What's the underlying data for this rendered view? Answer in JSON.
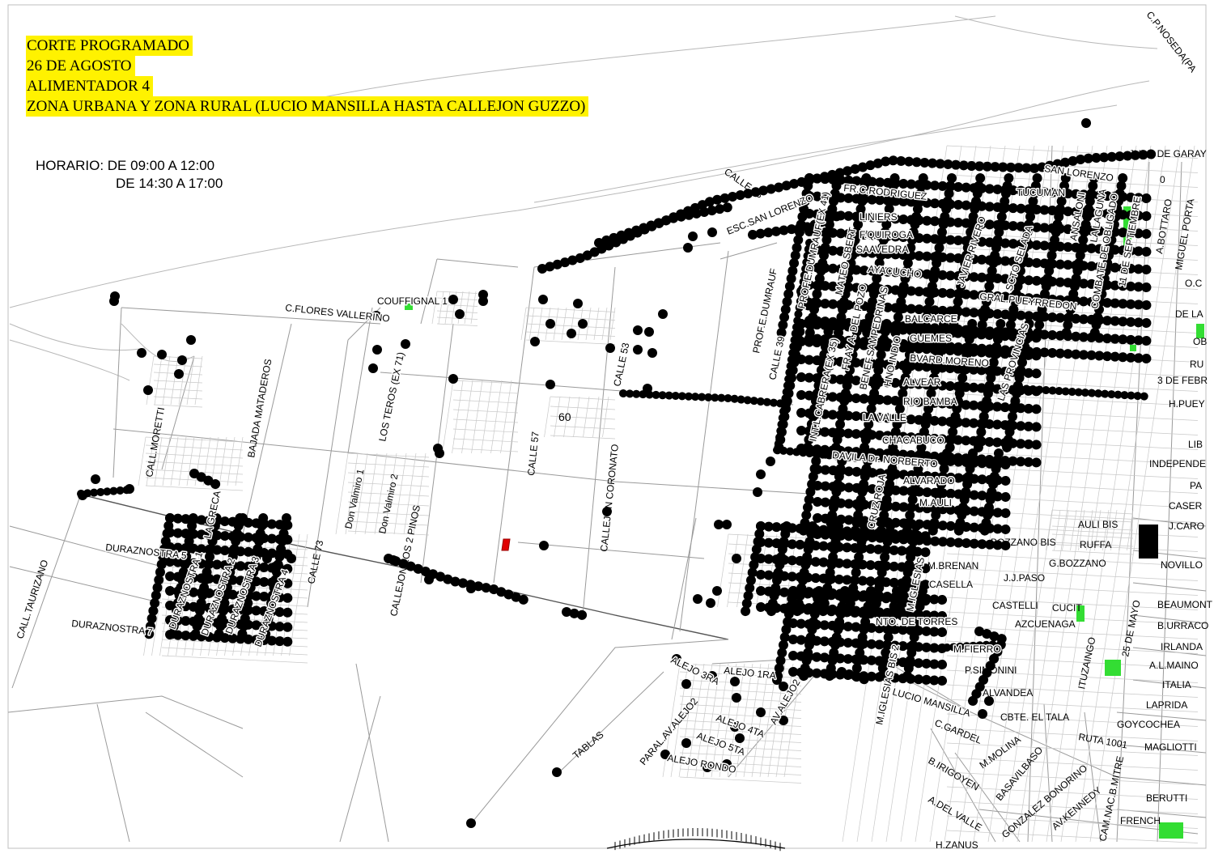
{
  "header": {
    "line1": "CORTE PROGRAMADO",
    "line2": "26 DE AGOSTO",
    "line3": "ALIMENTADOR 4",
    "line4": "ZONA URBANA  Y ZONA RURAL (LUCIO MANSILLA HASTA CALLEJON GUZZO)"
  },
  "schedule": {
    "label": "HORARIO: DE 09:00 A 12:00",
    "label2": "DE 14:30 A 17:00"
  },
  "colors": {
    "highlight": "#fff200",
    "affected": "#000000",
    "park": "#33dd33",
    "marker": "#e00000"
  },
  "labels": {
    "cp_noseda": "C.P.NOSEDA(PA",
    "juan_de_garay": "JUAN DE GARAY",
    "san_lorenzo": "SAN LORENZO",
    "calle_43": "CALLE 43",
    "esc_san_lorenzo": "ESC.SAN LORENZO",
    "fr_rodriguez": "FR.C.RODRIGUEZ",
    "tucuman": "TUCUMAN",
    "ansaloni": "ANSALONI",
    "la_laguna": "LA LAGUNA",
    "combate": "COMBATE DE OBLIGADO",
    "once_sept": "11 DE SEPTIEMBRE",
    "a_bottaro": "A.BOTTARO",
    "miguel_porta": "MIGUEL PORTA",
    "liniers": "LINIERS",
    "f_quiroga": "F.QUIROGA",
    "saavedra": "SAAVEDRA",
    "ayacucho": "AYACUCHO",
    "javier_rivero": "JAVIER RIVERO",
    "scto_selada": "SCTO SELADA",
    "gral_pueyrredon": "GRAL.PUEYRREDON",
    "mateo_sbert": "MATEO SBERT",
    "prof_dumrauf_41": "PROF.E.DUMRAUF(EX 41)",
    "prof_dumrauf": "PROF.E.DUMRAUF",
    "balcarce": "BALCARCE",
    "guemes": "GUEMES",
    "bvard_moreno": "BVARD.MORENO",
    "las_provincias": "LAS PROVINCIAS",
    "alvear": "ALVEAR",
    "rio_bamba": "RIO BAMBA",
    "la_valle": "LA VALLE",
    "chacabuco": "CHACABUCO",
    "fray_del_pozo": "FRAY A. DEL POZO",
    "benef_sampedrinas": "BENEF.SAMPEDRINAS",
    "hno_indio": "HNO.INDIO",
    "calle_39": "CALLE 39",
    "int_cabrera": "INT.L.CABRERA(EX 35)",
    "davila": "DAVILA Dr. NORBERTO",
    "alvarado": "ALVARADO",
    "m_auli": "M.AULI",
    "cruz_roja": "CRUZ ROJA",
    "auli_bis": "AULI BIS",
    "bozzano_bis": "BOZZANO BIS",
    "ruffa": "RUFFA",
    "j_caro": "J.CARO",
    "g_bozzano": "G.BOZZANO",
    "m_brenan": "M.BRENAN",
    "jj_paso": "J.J.PASO",
    "novillo": "NOVILLO",
    "casella": "CASELLA",
    "m_iglesias": "M.IGLESIAS",
    "castelli": "CASTELLI",
    "cucit": "CUCIT",
    "azcuenaga": "AZCUENAGA",
    "beaumont": "BEAUMONT",
    "b_urraco": "B.URRACO",
    "nto_torres": "NTO. DE TORRES",
    "m_fierro": "M.FIERRO",
    "ituzaingo": "ITUZAINGO",
    "veinticinco_mayo": "25 DE MAYO",
    "irlanda": "IRLANDA",
    "a_maino": "A.L.MAINO",
    "p_simonini": "P.SIMONINI",
    "m_iglesias_bis": "M.IGLESIAS BIS 2",
    "alvandea": "ALVANDEA",
    "italia": "ITALIA",
    "laprida": "LAPRIDA",
    "lucio_mansilla": "LUCIO MANSILLA",
    "cbte_el_tala": "CBTE. EL TALA",
    "goycochea": "GOYCOCHEA",
    "c_gardel": "C.GARDEL",
    "ruta_1001": "RUTA 1001",
    "magliotti": "MAGLIOTTI",
    "m_molina": "M.MOLINA",
    "b_irigoyen": "B.IRIGOYEN",
    "basavilbaso": "BASAVILBASO",
    "gonzalez_bonorino": "GONZALEZ BONORINO",
    "av_kennedy": "AV.KENNEDY",
    "cam_nac_mitre": "CAM.NAC.B.MITRE",
    "berutti": "BERUTTI",
    "a_del_valle": "A.DEL VALLE",
    "french": "FRENCH",
    "h_zanus": "H.ZANUS",
    "o_c": "O.C",
    "de_la": "DE LA",
    "ob": "OB",
    "ru": "RU",
    "tres_feb": "3 DE FEBR",
    "h_puey": "H.PUEY",
    "lib": "LIB",
    "independ": "INDEPENDE",
    "pa": "PA",
    "caser": "CASER",
    "cero": "0",
    "alejo_3ra": "ALEJO 3RA",
    "alejo_1ra": "ALEJO 1RA",
    "alejo_4ta": "ALEJO 4TA",
    "alejo_5ta": "ALEJO 5TA",
    "alejo_2": "AV.ALEJO2",
    "alejo_rondo": "ALEJO RONDO",
    "paral_av_alejo": "PARAL.AV.ALEJO2",
    "tablas": "TABLAS",
    "coufignal": "COUFFIGNAL 1",
    "c_flores": "C.FLORES VALLERINO",
    "los_teros": "LOS TEROS (EX 71)",
    "calle_53": "CALLE 53",
    "sixty": "60",
    "calle_57": "CALLE 57",
    "callejon_coronato": "CALLEJON CORONATO",
    "don_valmiro_1": "Don Valmiro 1",
    "don_valmiro_2": "Don Valmiro 2",
    "callejon_los_2_pinos": "CALLEJON LOS 2 PINOS",
    "call_moretti": "CALL.MORETTI",
    "bajada_mataderos": "BAJADA MATADEROS",
    "call_taurizano": "CALL.TAURIZANO",
    "duraznostra_5": "DURAZNOSTRA 5",
    "la_greca": "LA GRECA",
    "duraznostra_1": "DURAZNOSTRA 1",
    "duraznostra_2": "DURAZNOSTRA 2",
    "duraznostra_3": "DURAZNOSTRA 3",
    "duraznostra_4": "DURAZNOSTRA 4",
    "duraznostra_7": "DURAZNOSTRA 7",
    "calle_73": "CALLE 73"
  }
}
